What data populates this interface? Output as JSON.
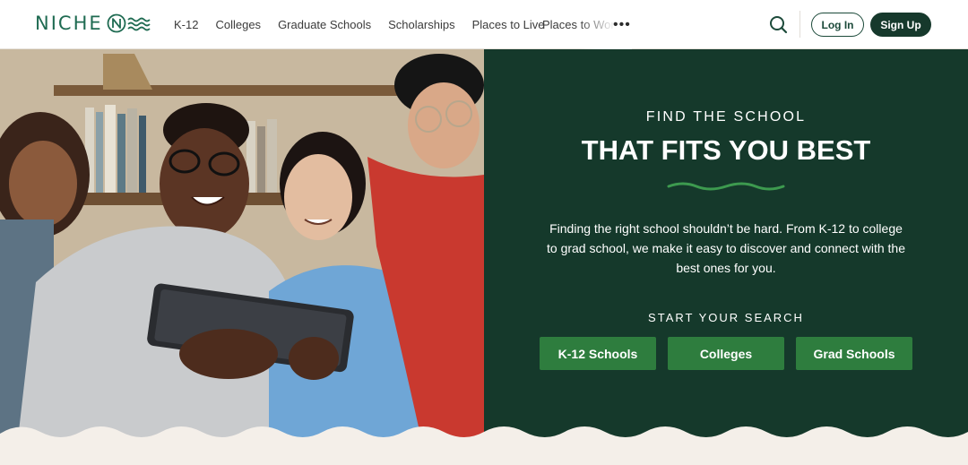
{
  "brand": {
    "name": "NICHE"
  },
  "nav": {
    "items": [
      {
        "label": "K-12"
      },
      {
        "label": "Colleges"
      },
      {
        "label": "Graduate Schools"
      },
      {
        "label": "Scholarships"
      },
      {
        "label": "Places to Live"
      }
    ],
    "truncated_item": "Places to Work",
    "more_label": "•••"
  },
  "header": {
    "login_label": "Log In",
    "signup_label": "Sign Up",
    "search_icon": "search-icon"
  },
  "hero": {
    "kicker": "FIND THE SCHOOL",
    "title": "THAT FITS YOU BEST",
    "description": "Finding the right school shouldn’t be hard. From K-12 to college to grad school, we make it easy to discover and connect with the best ones for you.",
    "search_label": "START YOUR SEARCH",
    "buttons": [
      {
        "label": "K-12 Schools"
      },
      {
        "label": "Colleges"
      },
      {
        "label": "Grad Schools"
      }
    ]
  },
  "colors": {
    "brand_green": "#1f6b52",
    "panel_green": "#15392b",
    "button_green": "#2e7d3e",
    "cream": "#f4efe9"
  }
}
